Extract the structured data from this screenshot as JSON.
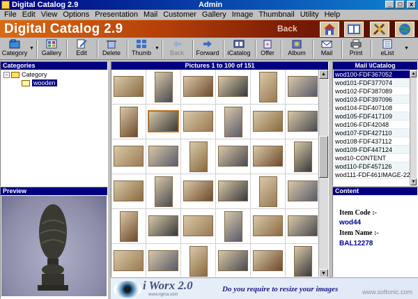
{
  "window": {
    "app_title": "Digital Catalog 2.9",
    "user": "Admin",
    "min_label": "_",
    "max_label": "□",
    "close_label": "x"
  },
  "menu": [
    "File",
    "Edit",
    "View",
    "Options",
    "Presentation",
    "Mail",
    "Customer",
    "Gallery",
    "Image",
    "Thumbnail",
    "Utility",
    "Help"
  ],
  "banner": {
    "brand": "Digital Catalog 2.9",
    "back": "Back",
    "icons": [
      "home-icon",
      "book-icon",
      "tools-icon",
      "globe-icon"
    ]
  },
  "toolbar": {
    "buttons": [
      {
        "label": "Category",
        "icon": "category-icon",
        "enabled": true,
        "dropdown": true
      },
      {
        "label": "Gallery",
        "icon": "gallery-icon",
        "enabled": true
      },
      {
        "label": "Edit",
        "icon": "edit-icon",
        "enabled": true
      },
      {
        "label": "Delete",
        "icon": "delete-icon",
        "enabled": true
      },
      {
        "label": "Thumb",
        "icon": "thumb-icon",
        "enabled": true,
        "dropdown": true
      },
      {
        "label": "Back",
        "icon": "back-arrow-icon",
        "enabled": false
      },
      {
        "label": "Forward",
        "icon": "forward-arrow-icon",
        "enabled": true
      },
      {
        "label": "iCatalog",
        "icon": "icatalog-icon",
        "enabled": true
      },
      {
        "label": "Offer",
        "icon": "offer-icon",
        "enabled": true
      },
      {
        "label": "Album",
        "icon": "album-icon",
        "enabled": true
      },
      {
        "label": "Mail",
        "icon": "mail-icon",
        "enabled": true
      },
      {
        "label": "Print",
        "icon": "print-icon",
        "enabled": true
      },
      {
        "label": "eList",
        "icon": "elist-icon",
        "enabled": true,
        "dropdown": true
      }
    ]
  },
  "categories": {
    "header": "Categories",
    "expander": "−",
    "root": "Category",
    "child": "wooden"
  },
  "preview": {
    "header": "Preview"
  },
  "pictures": {
    "header": "Pictures 1 to 100 of 151",
    "rows": 6,
    "cols": 6,
    "selected_index": 7
  },
  "mail_catalog": {
    "header": "Mail \\iCatalog",
    "items": [
      "wod100-FDF367052",
      "wod101-FDF377074",
      "wod102-FDF387089",
      "wod103-FDF397096",
      "wod104-FDF407108",
      "wod105-FDF417109",
      "wod106-FDF42048",
      "wod107-FDF427110",
      "wod108-FDF437112",
      "wod109-FDF447124",
      "wod10-CONTENT",
      "wod110-FDF457126",
      "wod111-FDF461IMAGE-22"
    ],
    "selected_index": 0
  },
  "content": {
    "header": "Content",
    "item_code_label": "Item Code :-",
    "item_code_value": "wod44",
    "item_name_label": "Item Name :-",
    "item_name_value": "BAL12278"
  },
  "ad": {
    "brand": "i Worx 2.0",
    "sub": "www.rigma.com",
    "tagline": "Do you require to resize your images",
    "watermark": "www.softonic.com"
  }
}
